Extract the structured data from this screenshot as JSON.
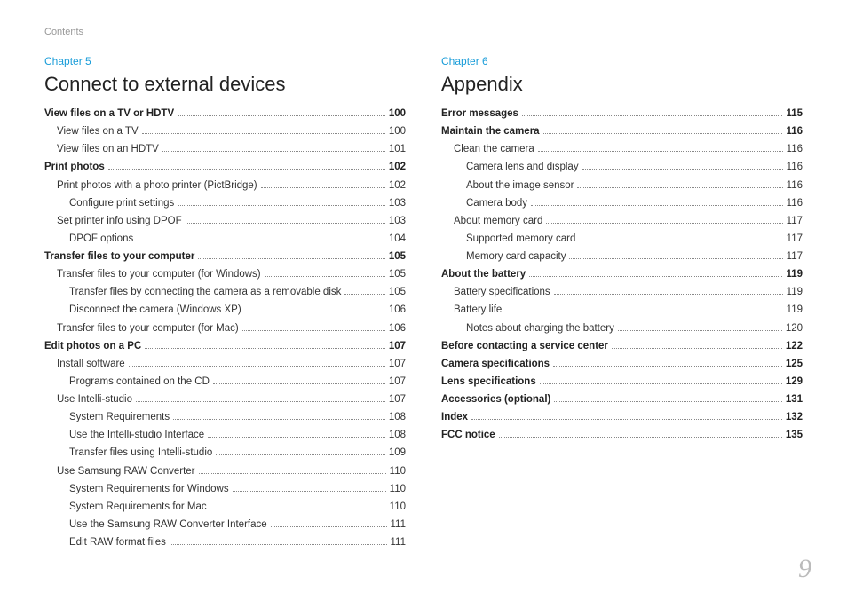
{
  "header": "Contents",
  "page_number": "9",
  "columns": [
    {
      "chapter_label": "Chapter 5",
      "chapter_title": "Connect to external devices",
      "entries": [
        {
          "label": "View files on a TV or HDTV",
          "page": "100",
          "level": 0,
          "bold": true
        },
        {
          "label": "View files on a TV",
          "page": "100",
          "level": 1,
          "bold": false
        },
        {
          "label": "View files on an HDTV",
          "page": "101",
          "level": 1,
          "bold": false
        },
        {
          "label": "Print photos",
          "page": "102",
          "level": 0,
          "bold": true
        },
        {
          "label": "Print photos with a photo printer (PictBridge)",
          "page": "102",
          "level": 1,
          "bold": false
        },
        {
          "label": "Configure print settings",
          "page": "103",
          "level": 2,
          "bold": false
        },
        {
          "label": "Set printer info using DPOF",
          "page": "103",
          "level": 1,
          "bold": false
        },
        {
          "label": "DPOF options",
          "page": "104",
          "level": 2,
          "bold": false
        },
        {
          "label": "Transfer files to your computer",
          "page": "105",
          "level": 0,
          "bold": true
        },
        {
          "label": "Transfer files to your computer (for Windows)",
          "page": "105",
          "level": 1,
          "bold": false
        },
        {
          "label": "Transfer files by connecting the camera as a removable disk",
          "page": "105",
          "level": 2,
          "bold": false
        },
        {
          "label": "Disconnect the camera (Windows XP)",
          "page": "106",
          "level": 2,
          "bold": false
        },
        {
          "label": "Transfer files to your computer (for Mac)",
          "page": "106",
          "level": 1,
          "bold": false
        },
        {
          "label": "Edit photos on a PC",
          "page": "107",
          "level": 0,
          "bold": true
        },
        {
          "label": "Install software",
          "page": "107",
          "level": 1,
          "bold": false
        },
        {
          "label": "Programs contained on the CD",
          "page": "107",
          "level": 2,
          "bold": false
        },
        {
          "label": "Use Intelli-studio",
          "page": "107",
          "level": 1,
          "bold": false
        },
        {
          "label": "System Requirements",
          "page": "108",
          "level": 2,
          "bold": false
        },
        {
          "label": "Use the Intelli-studio Interface",
          "page": "108",
          "level": 2,
          "bold": false
        },
        {
          "label": "Transfer files using Intelli-studio",
          "page": "109",
          "level": 2,
          "bold": false
        },
        {
          "label": "Use Samsung RAW Converter",
          "page": "110",
          "level": 1,
          "bold": false
        },
        {
          "label": "System Requirements for Windows",
          "page": "110",
          "level": 2,
          "bold": false
        },
        {
          "label": "System Requirements for Mac",
          "page": "110",
          "level": 2,
          "bold": false
        },
        {
          "label": "Use the Samsung RAW Converter Interface",
          "page": "111",
          "level": 2,
          "bold": false
        },
        {
          "label": "Edit RAW format files",
          "page": "111",
          "level": 2,
          "bold": false
        }
      ]
    },
    {
      "chapter_label": "Chapter 6",
      "chapter_title": "Appendix",
      "entries": [
        {
          "label": "Error messages",
          "page": "115",
          "level": 0,
          "bold": true
        },
        {
          "label": "Maintain the camera",
          "page": "116",
          "level": 0,
          "bold": true
        },
        {
          "label": "Clean the camera",
          "page": "116",
          "level": 1,
          "bold": false
        },
        {
          "label": "Camera lens and display",
          "page": "116",
          "level": 2,
          "bold": false
        },
        {
          "label": "About the image sensor",
          "page": "116",
          "level": 2,
          "bold": false
        },
        {
          "label": "Camera body",
          "page": "116",
          "level": 2,
          "bold": false
        },
        {
          "label": "About memory card",
          "page": "117",
          "level": 1,
          "bold": false
        },
        {
          "label": "Supported memory card",
          "page": "117",
          "level": 2,
          "bold": false
        },
        {
          "label": "Memory card capacity",
          "page": "117",
          "level": 2,
          "bold": false
        },
        {
          "label": "About the battery",
          "page": "119",
          "level": 0,
          "bold": true
        },
        {
          "label": "Battery specifications",
          "page": "119",
          "level": 1,
          "bold": false
        },
        {
          "label": "Battery life",
          "page": "119",
          "level": 1,
          "bold": false
        },
        {
          "label": "Notes about charging the battery",
          "page": "120",
          "level": 2,
          "bold": false
        },
        {
          "label": "Before contacting a service center",
          "page": "122",
          "level": 0,
          "bold": true
        },
        {
          "label": "Camera specifications",
          "page": "125",
          "level": 0,
          "bold": true
        },
        {
          "label": "Lens specifications",
          "page": "129",
          "level": 0,
          "bold": true
        },
        {
          "label": "Accessories (optional)",
          "page": "131",
          "level": 0,
          "bold": true
        },
        {
          "label": "Index",
          "page": "132",
          "level": 0,
          "bold": true
        },
        {
          "label": "FCC notice",
          "page": "135",
          "level": 0,
          "bold": true
        }
      ]
    }
  ]
}
